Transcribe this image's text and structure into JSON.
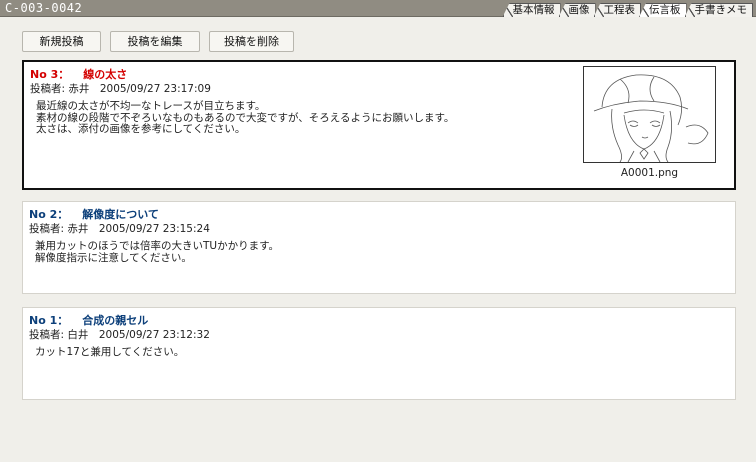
{
  "header": {
    "record_id": "C-003-0042",
    "tabs": [
      {
        "label": "基本情報",
        "active": false
      },
      {
        "label": "画像",
        "active": false
      },
      {
        "label": "工程表",
        "active": false
      },
      {
        "label": "伝言板",
        "active": true
      },
      {
        "label": "手書きメモ",
        "active": false
      }
    ]
  },
  "toolbar": {
    "new_label": "新規投稿",
    "edit_label": "投稿を編集",
    "delete_label": "投稿を削除"
  },
  "posts": [
    {
      "number": "No 3：",
      "title": "線の太さ",
      "meta": "投稿者: 赤井　2005/09/27 23:17:09",
      "lines": [
        "最近線の太さが不均一なトレースが目立ちます。",
        "素材の線の段階で不ぞろいなものもあるので大変ですが、そろえるようにお願いします。",
        "太さは、添付の画像を参考にしてください。"
      ],
      "attachment": "A0001.png",
      "selected": true
    },
    {
      "number": "No 2：",
      "title": "解像度について",
      "meta": "投稿者: 赤井　2005/09/27 23:15:24",
      "lines": [
        "兼用カットのほうでは倍率の大きいTUかかります。",
        "解像度指示に注意してください。"
      ]
    },
    {
      "number": "No 1：",
      "title": "合成の親セル",
      "meta": "投稿者: 白井　2005/09/27 23:12:32",
      "lines": [
        "カット17と兼用してください。"
      ]
    }
  ]
}
